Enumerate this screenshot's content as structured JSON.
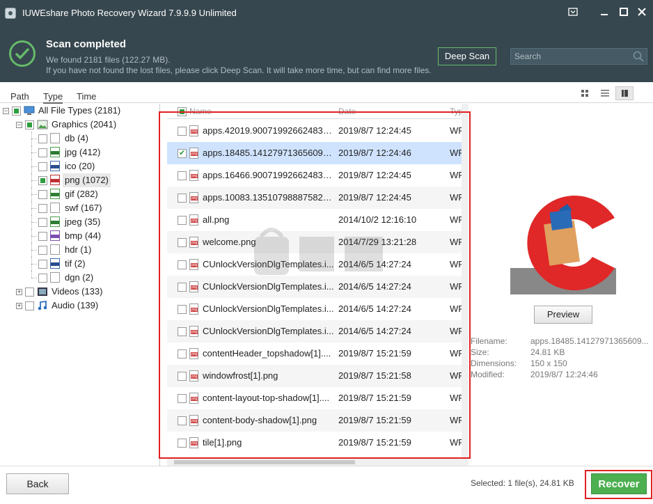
{
  "window": {
    "title": "IUWEshare Photo Recovery Wizard 7.9.9.9 Unlimited"
  },
  "header": {
    "scan_title": "Scan completed",
    "found_text": "We found 2181 files (122.27 MB).",
    "hint_text": "If you have not found the lost files, please click Deep Scan. It will take more time, but can find more files.",
    "deep_scan_label": "Deep Scan",
    "search_placeholder": "Search"
  },
  "tabs": [
    {
      "label": "Path"
    },
    {
      "label": "Type"
    },
    {
      "label": "Time"
    }
  ],
  "tree": {
    "root": "All File Types (2181)",
    "graphics": "Graphics (2041)",
    "graphics_items": [
      {
        "label": "db (4)"
      },
      {
        "label": "jpg (412)"
      },
      {
        "label": "ico (20)"
      },
      {
        "label": "png (1072)"
      },
      {
        "label": "gif (282)"
      },
      {
        "label": "swf (167)"
      },
      {
        "label": "jpeg (35)"
      },
      {
        "label": "bmp (44)"
      },
      {
        "label": "hdr (1)"
      },
      {
        "label": "tif (2)"
      },
      {
        "label": "dgn (2)"
      }
    ],
    "videos": "Videos (133)",
    "audio": "Audio (139)"
  },
  "list": {
    "columns": [
      "Name",
      "Date",
      "Typ"
    ],
    "rows": [
      {
        "name": "apps.42019.900719926624838...",
        "date": "2019/8/7 12:24:45",
        "type": "WF"
      },
      {
        "name": "apps.18485.141279713656099...",
        "date": "2019/8/7 12:24:46",
        "type": "WF"
      },
      {
        "name": "apps.16466.900719926624839...",
        "date": "2019/8/7 12:24:45",
        "type": "WF"
      },
      {
        "name": "apps.10083.135107988875821...",
        "date": "2019/8/7 12:24:45",
        "type": "WF"
      },
      {
        "name": "all.png",
        "date": "2014/10/2 12:16:10",
        "type": "WF"
      },
      {
        "name": "welcome.png",
        "date": "2014/7/29 13:21:28",
        "type": "WF"
      },
      {
        "name": "CUnlockVersionDlgTemplates.i...",
        "date": "2014/6/5 14:27:24",
        "type": "WF"
      },
      {
        "name": "CUnlockVersionDlgTemplates.i...",
        "date": "2014/6/5 14:27:24",
        "type": "WF"
      },
      {
        "name": "CUnlockVersionDlgTemplates.i...",
        "date": "2014/6/5 14:27:24",
        "type": "WF"
      },
      {
        "name": "CUnlockVersionDlgTemplates.i...",
        "date": "2014/6/5 14:27:24",
        "type": "WF"
      },
      {
        "name": "contentHeader_topshadow[1]....",
        "date": "2019/8/7 15:21:59",
        "type": "WF"
      },
      {
        "name": "windowfrost[1].png",
        "date": "2019/8/7 15:21:58",
        "type": "WF"
      },
      {
        "name": "content-layout-top-shadow[1]....",
        "date": "2019/8/7 15:21:59",
        "type": "WF"
      },
      {
        "name": "content-body-shadow[1].png",
        "date": "2019/8/7 15:21:59",
        "type": "WF"
      },
      {
        "name": "tile[1].png",
        "date": "2019/8/7 15:21:59",
        "type": "WF"
      }
    ]
  },
  "preview": {
    "button_label": "Preview",
    "filename_label": "Filename:",
    "filename_value": "apps.18485.14127971365609...",
    "size_label": "Size:",
    "size_value": "24.81 KB",
    "dimensions_label": "Dimensions:",
    "dimensions_value": "150 x 150",
    "modified_label": "Modified:",
    "modified_value": "2019/8/7 12:24:46"
  },
  "footer": {
    "back_label": "Back",
    "selected_text": "Selected: 1 file(s), 24.81 KB",
    "recover_label": "Recover"
  },
  "colors": {
    "header_bg": "#37474f",
    "accent_green": "#4caf50",
    "highlight_red": "#e02020",
    "selected_row": "#cfe3ff"
  }
}
